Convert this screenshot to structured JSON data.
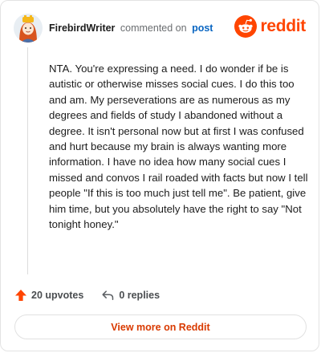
{
  "header": {
    "username": "FirebirdWriter",
    "action_text": "commented on",
    "post_link": "post",
    "brand_name": "reddit"
  },
  "comment": {
    "body": "NTA. You're expressing a need. I do wonder if be is autistic or otherwise misses social cues. I do this too and am. My perseverations are as numerous as my degrees and fields of study I abandoned without a degree. It isn't personal now but at first I was confused and hurt because my brain is always wanting more information. I have no idea how many social cues I missed and convos I rail roaded with facts but now I tell people \"If this is too much just tell me\". Be patient, give him time, but you absolutely have the right to say \"Not tonight honey.\""
  },
  "actions": {
    "upvotes_label": "20 upvotes",
    "replies_label": "0 replies"
  },
  "footer": {
    "view_more_label": "View more on Reddit"
  },
  "icons": {
    "avatar": "user-avatar",
    "brand": "reddit-logo-icon",
    "upvote": "upvote-arrow-icon",
    "reply": "reply-arrow-icon"
  },
  "colors": {
    "brand_orange": "#ff4500",
    "link_blue": "#0a66c2",
    "view_more_text": "#d93a00",
    "upvote_orange": "#ff4500"
  }
}
